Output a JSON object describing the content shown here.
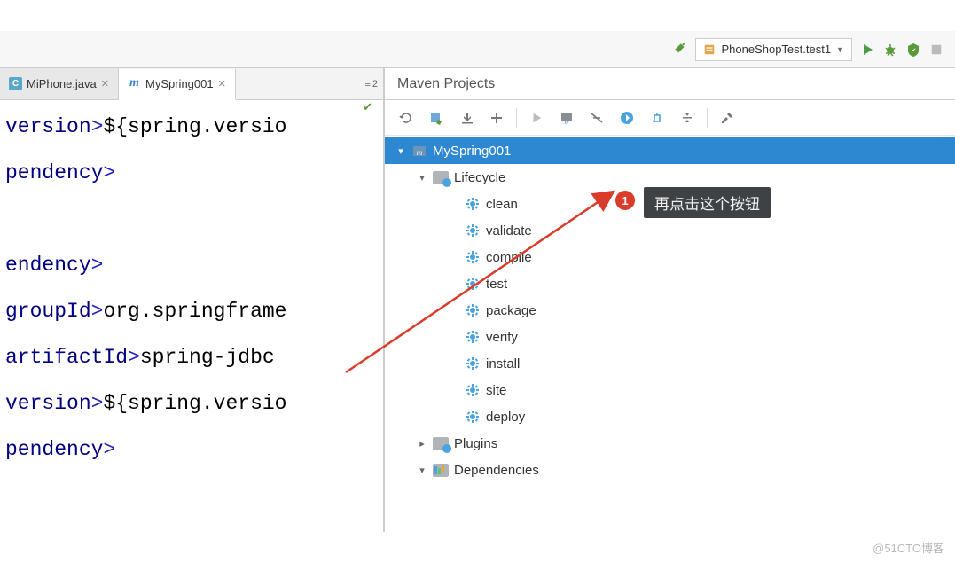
{
  "toolbar": {
    "run_config_label": "PhoneShopTest.test1"
  },
  "editor": {
    "tabs": [
      {
        "icon_bg": "#5aa7c7",
        "icon_fg": "#fff",
        "icon_letter": "C",
        "label": "MiPhone.java",
        "active": false
      },
      {
        "icon_bg": "#fff",
        "icon_fg": "#3a83d6",
        "icon_letter": "m",
        "label": "MySpring001",
        "active": true
      }
    ],
    "tab_count_label": "2",
    "code_lines": [
      {
        "open": "version",
        "text": "${spring.versio",
        "close": ""
      },
      {
        "open": "",
        "text": "",
        "close": "pendency"
      },
      {
        "open": "",
        "text": "",
        "close": ""
      },
      {
        "open": "endency",
        "text": "",
        "close": ""
      },
      {
        "open": "groupId",
        "text": "org.springframe",
        "close": ""
      },
      {
        "open": "artifactId",
        "text": "spring-jdbc",
        "close": ""
      },
      {
        "open": "version",
        "text": "${spring.versio",
        "close": ""
      },
      {
        "open": "",
        "text": "",
        "close": "pendency"
      }
    ]
  },
  "maven": {
    "panel_title": "Maven Projects",
    "root": "MySpring001",
    "lifecycle_label": "Lifecycle",
    "lifecycle_items": [
      "clean",
      "validate",
      "compile",
      "test",
      "package",
      "verify",
      "install",
      "site",
      "deploy"
    ],
    "plugins_label": "Plugins",
    "dependencies_label": "Dependencies"
  },
  "annotation": {
    "badge": "1",
    "tooltip": "再点击这个按钮"
  },
  "watermark": "@51CTO博客"
}
